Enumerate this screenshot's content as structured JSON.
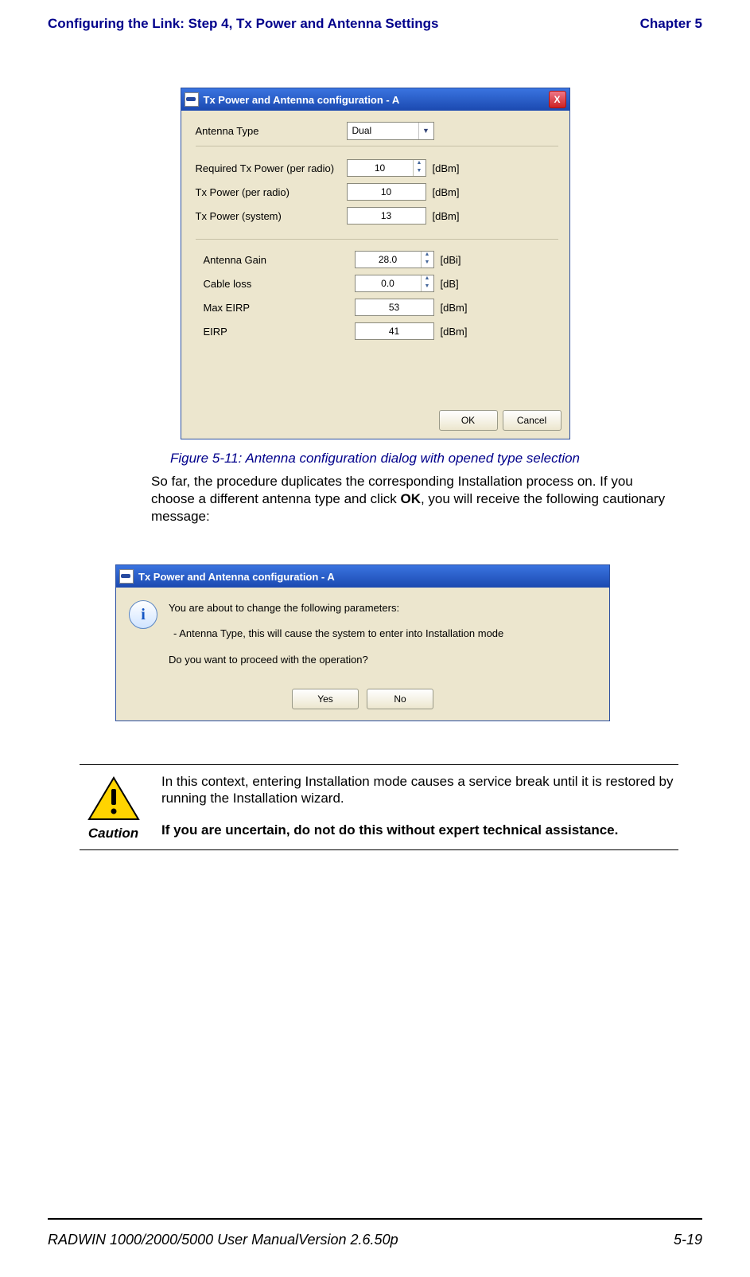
{
  "header": {
    "left": "Configuring the Link: Step 4, Tx Power and Antenna Settings",
    "right": "Chapter 5"
  },
  "dialog1": {
    "title": "Tx Power and Antenna configuration - A",
    "close_glyph": "X",
    "antenna_type": {
      "label": "Antenna Type",
      "value": "Dual"
    },
    "rows": [
      {
        "label": "Required Tx Power (per radio)",
        "value": "10",
        "unit": "[dBm]",
        "spin": true
      },
      {
        "label": "Tx Power (per radio)",
        "value": "10",
        "unit": "[dBm]",
        "spin": false
      },
      {
        "label": "Tx Power (system)",
        "value": "13",
        "unit": "[dBm]",
        "spin": false
      }
    ],
    "rows2": [
      {
        "label": "Antenna Gain",
        "value": "28.0",
        "unit": "[dBi]",
        "spin": true
      },
      {
        "label": "Cable loss",
        "value": "0.0",
        "unit": "[dB]",
        "spin": true
      },
      {
        "label": "Max EIRP",
        "value": "53",
        "unit": "[dBm]",
        "spin": false
      },
      {
        "label": "EIRP",
        "value": "41",
        "unit": "[dBm]",
        "spin": false
      }
    ],
    "ok": "OK",
    "cancel": "Cancel"
  },
  "fig_caption": "Figure 5-11:  Antenna configuration dialog with opened type selection",
  "paragraph": {
    "t1": "So far, the procedure duplicates the corresponding Installation process on. If you choose a different antenna type and click ",
    "bold": "OK",
    "t2": ", you will receive the following cautionary message:"
  },
  "dialog2": {
    "title": "Tx Power and Antenna configuration - A",
    "line1": "You are about to change the following parameters:",
    "line2": "- Antenna Type, this will cause the system to enter into Installation mode",
    "line3": "Do you want to proceed with the operation?",
    "yes": "Yes",
    "no": "No"
  },
  "caution": {
    "label": "Caution",
    "text": "In this context, entering Installation mode causes a service break until it is restored by running the Installation wizard.",
    "bold": "If you are uncertain, do not do this without expert technical assistance."
  },
  "footer": {
    "left": "RADWIN 1000/2000/5000 User ManualVersion  2.6.50p",
    "right": "5-19"
  }
}
